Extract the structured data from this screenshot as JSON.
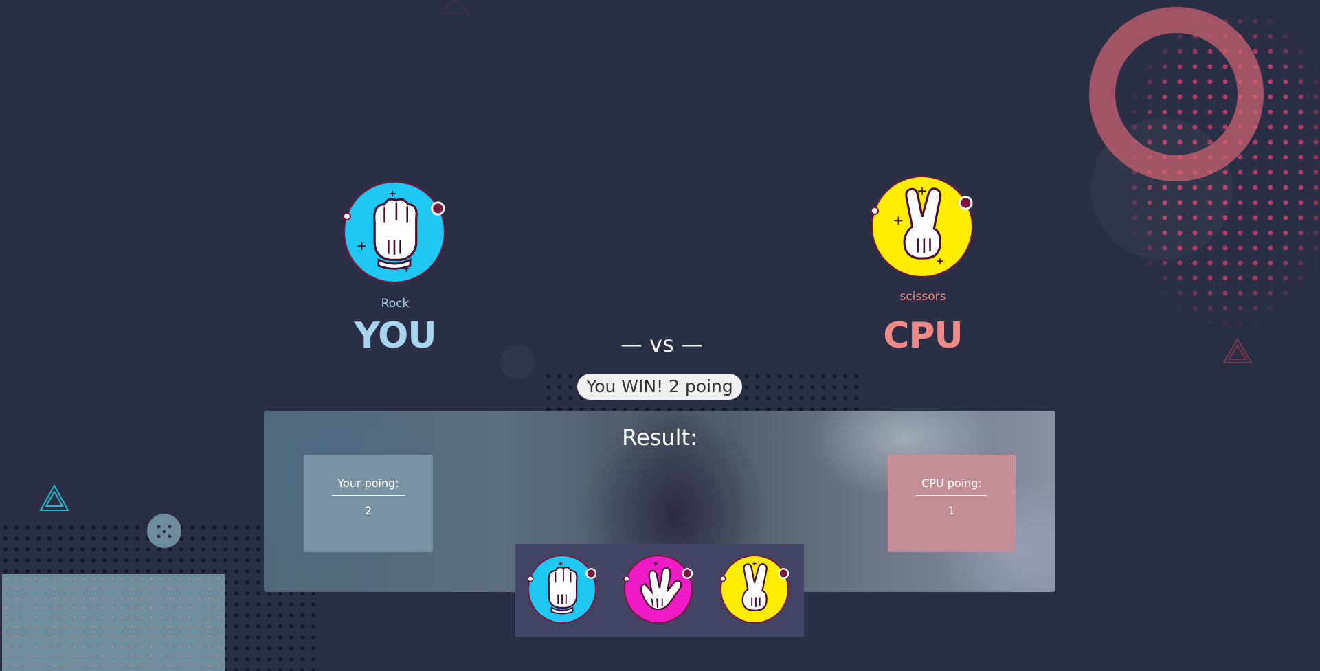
{
  "player": {
    "name": "YOU",
    "choice_label": "Rock",
    "choice_icon": "rock-hand-icon",
    "color": "#a8d4ee"
  },
  "cpu": {
    "name": "CPU",
    "choice_label": "scissors",
    "choice_icon": "scissors-hand-icon",
    "color": "#f08a86"
  },
  "vs_text": "— vs —",
  "round_result": "You WIN! 2 poing",
  "result_panel": {
    "title": "Result:",
    "your_score_label": "Your poing:",
    "your_score": 2,
    "cpu_score_label": "CPU poing:",
    "cpu_score": 1
  },
  "picker": {
    "options": [
      {
        "name": "rock",
        "icon": "rock-hand-icon",
        "color": "#1ec8f2"
      },
      {
        "name": "paper",
        "icon": "paper-hand-icon",
        "color": "#ee1bc6"
      },
      {
        "name": "scissors",
        "icon": "scissors-hand-icon",
        "color": "#ffee00"
      }
    ]
  },
  "colors": {
    "background": "#2a2f45",
    "rock": "#1ec8f2",
    "paper": "#ee1bc6",
    "scissors": "#ffee00",
    "accent_ring": "#7a1640",
    "your_box": "#7a93a5",
    "cpu_box": "#c48e98"
  }
}
